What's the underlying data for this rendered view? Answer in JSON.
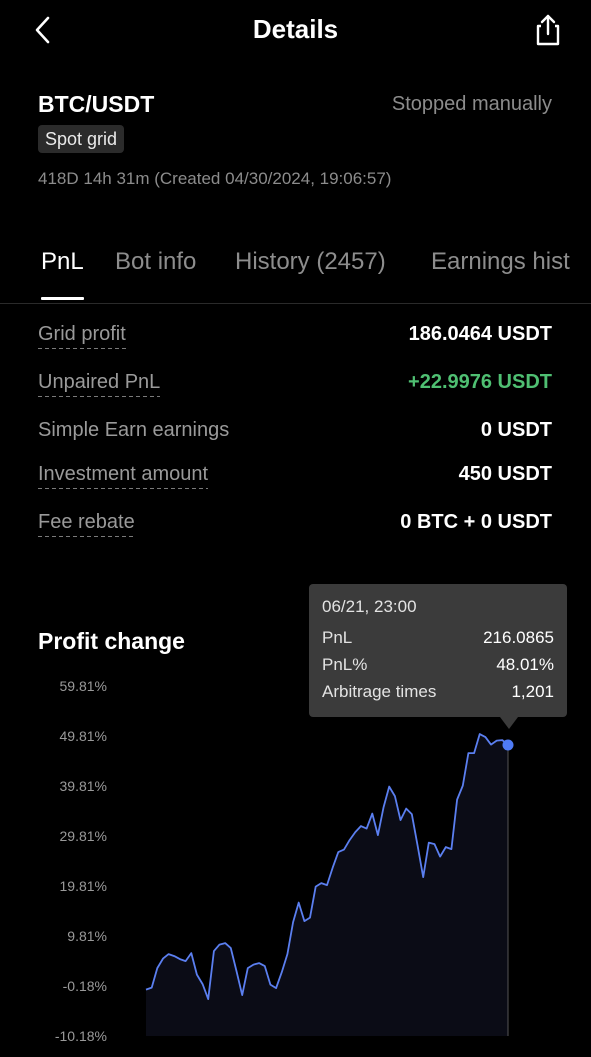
{
  "header": {
    "title": "Details",
    "back_icon": "chevron-left-icon",
    "share_icon": "share-icon"
  },
  "summary": {
    "pair": "BTC/USDT",
    "status": "Stopped manually",
    "badge": "Spot grid",
    "duration": "418D 14h 31m (Created 04/30/2024, 19:06:57)"
  },
  "tabs": [
    {
      "label": "PnL",
      "active": true
    },
    {
      "label": "Bot info",
      "active": false
    },
    {
      "label": "History (2457)",
      "active": false
    },
    {
      "label": "Earnings hist",
      "active": false
    }
  ],
  "stats": [
    {
      "label": "Grid profit",
      "value": "186.0464 USDT",
      "dashed": true,
      "positive": false
    },
    {
      "label": "Unpaired PnL",
      "value": "+22.9976 USDT",
      "dashed": true,
      "positive": true
    },
    {
      "label": "Simple Earn earnings",
      "value": "0 USDT",
      "dashed": false,
      "positive": false
    },
    {
      "label": "Investment amount",
      "value": "450 USDT",
      "dashed": true,
      "positive": false
    },
    {
      "label": "Fee rebate",
      "value": "0 BTC + 0 USDT",
      "dashed": true,
      "positive": false
    }
  ],
  "chart_title": "Profit change",
  "tooltip": {
    "date": "06/21, 23:00",
    "rows": [
      {
        "label": "PnL",
        "value": "216.0865"
      },
      {
        "label": "PnL%",
        "value": "48.01%"
      },
      {
        "label": "Arbitrage times",
        "value": "1,201"
      }
    ]
  },
  "colors": {
    "line": "#5b7ff0",
    "point": "#4f7bf5",
    "positive": "#4fbf72"
  },
  "chart_data": {
    "type": "line",
    "title": "Profit change",
    "y_tick_labels": [
      "59.81%",
      "49.81%",
      "39.81%",
      "29.81%",
      "19.81%",
      "9.81%",
      "-0.18%",
      "-10.18%"
    ],
    "ylim": [
      -10.18,
      59.81
    ],
    "grid": false,
    "series": [
      {
        "values": [
          -0.9,
          -0.5,
          3.4,
          5.3,
          6.2,
          5.8,
          5.2,
          4.8,
          6.4,
          2.1,
          0.2,
          -2.8,
          6.8,
          8.1,
          8.4,
          7.4,
          2.8,
          -2.0,
          3.4,
          4.1,
          4.4,
          3.8,
          0.1,
          -0.6,
          2.6,
          6.2,
          12.6,
          16.5,
          12.8,
          13.5,
          19.7,
          20.4,
          20.0,
          23.5,
          26.6,
          27.1,
          29.0,
          30.6,
          31.8,
          31.3,
          34.3,
          30.0,
          35.6,
          39.7,
          37.8,
          33.0,
          35.3,
          34.2,
          28.0,
          21.6,
          28.5,
          28.2,
          25.7,
          27.6,
          27.2,
          37.1,
          39.9,
          46.4,
          46.4,
          50.2,
          49.6,
          48.1,
          48.9,
          49.0,
          48.01
        ]
      }
    ]
  }
}
